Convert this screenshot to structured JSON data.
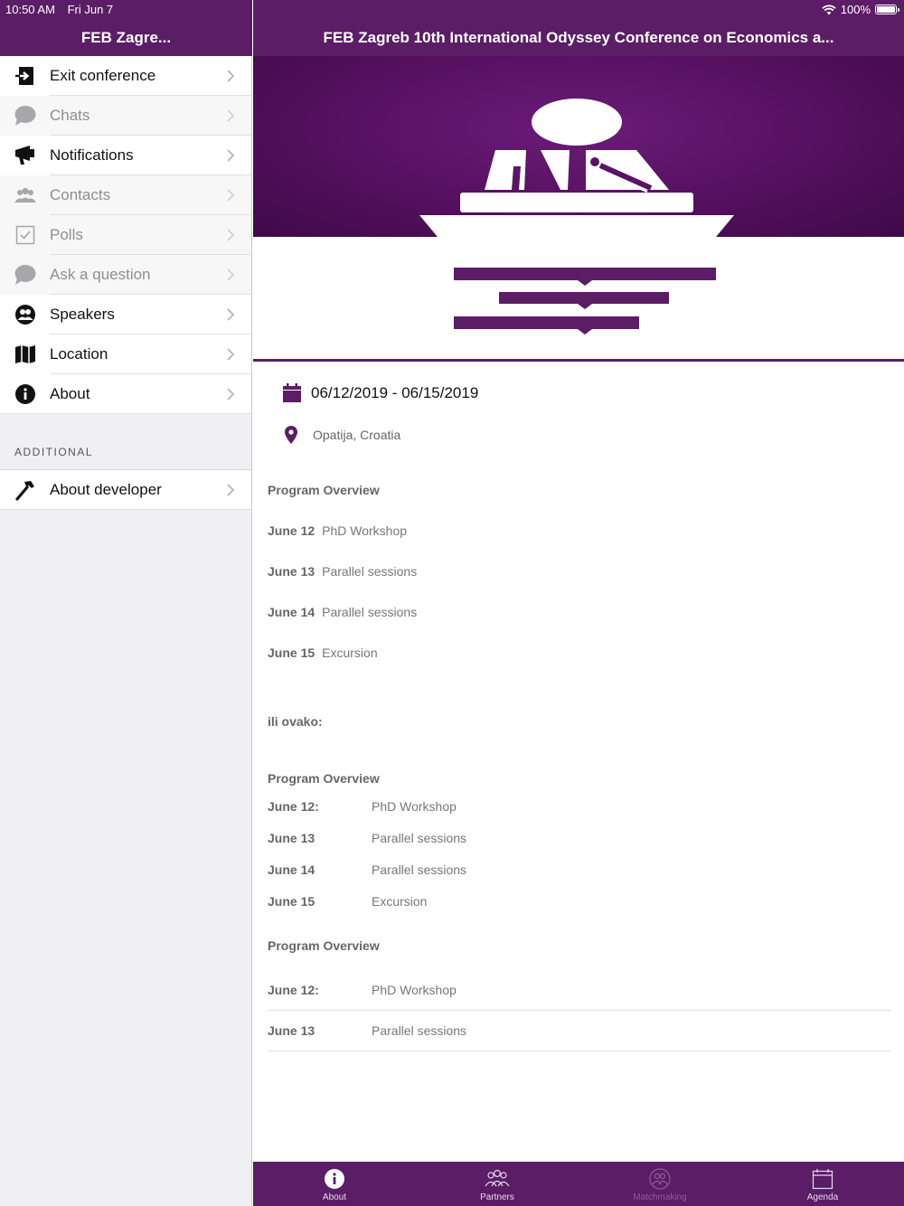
{
  "status": {
    "time": "10:50 AM",
    "date": "Fri Jun 7",
    "battery": "100%",
    "battery_level": 1.0
  },
  "sidebar": {
    "title": "FEB Zagre...",
    "items": [
      {
        "label": "Exit conference",
        "icon": "exit-icon",
        "enabled": true
      },
      {
        "label": "Chats",
        "icon": "chat-icon",
        "enabled": false
      },
      {
        "label": "Notifications",
        "icon": "megaphone-icon",
        "enabled": true
      },
      {
        "label": "Contacts",
        "icon": "contacts-icon",
        "enabled": false
      },
      {
        "label": "Polls",
        "icon": "checkbox-icon",
        "enabled": false
      },
      {
        "label": "Ask a question",
        "icon": "chat-icon",
        "enabled": false
      },
      {
        "label": "Speakers",
        "icon": "speakers-icon",
        "enabled": true
      },
      {
        "label": "Location",
        "icon": "map-icon",
        "enabled": true
      },
      {
        "label": "About",
        "icon": "info-icon",
        "enabled": true
      }
    ],
    "section_header": "ADDITIONAL",
    "additional_items": [
      {
        "label": "About developer",
        "icon": "hammer-icon",
        "enabled": true
      }
    ]
  },
  "main": {
    "title": "FEB Zagreb 10th International Odyssey Conference on Economics a...",
    "date_range": "06/12/2019 - 06/15/2019",
    "location": "Opatija, Croatia",
    "program1": {
      "title": "Program Overview",
      "rows": [
        {
          "day": "June 12",
          "event": "PhD Workshop"
        },
        {
          "day": "June 13",
          "event": "Parallel sessions"
        },
        {
          "day": "June 14",
          "event": "Parallel sessions"
        },
        {
          "day": "June 15",
          "event": "Excursion"
        }
      ]
    },
    "note": "ili ovako:",
    "program2": {
      "title": "Program Overview",
      "rows": [
        {
          "day": "June 12:",
          "event": "PhD Workshop"
        },
        {
          "day": "June 13",
          "event": "Parallel sessions"
        },
        {
          "day": "June 14",
          "event": "Parallel sessions"
        },
        {
          "day": "June 15",
          "event": "Excursion"
        }
      ]
    },
    "program3": {
      "title": "Program Overview",
      "rows": [
        {
          "day": "June 12:",
          "event": "PhD Workshop"
        },
        {
          "day": "June 13",
          "event": "Parallel sessions"
        }
      ]
    }
  },
  "tabs": [
    {
      "label": "About",
      "icon": "info-icon",
      "active": true
    },
    {
      "label": "Partners",
      "icon": "partners-icon",
      "active": false
    },
    {
      "label": "Matchmaking",
      "icon": "matchmaking-icon",
      "active": false,
      "disabled": true
    },
    {
      "label": "Agenda",
      "icon": "calendar-icon",
      "active": false
    }
  ],
  "colors": {
    "brand": "#5b1d66",
    "sidebar_bg": "#efeff4",
    "disabled_text": "#8e8e93"
  }
}
